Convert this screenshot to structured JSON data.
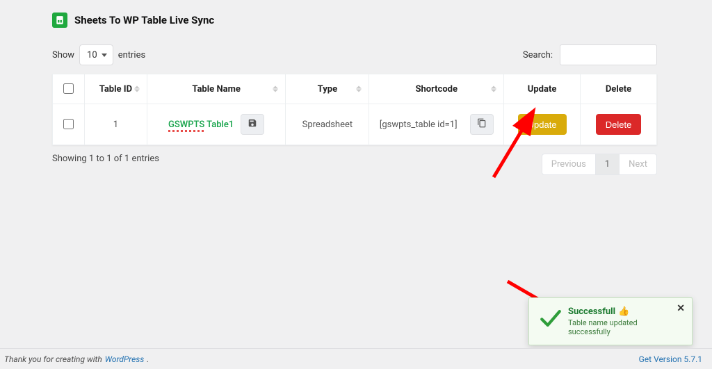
{
  "header": {
    "title": "Sheets To WP Table Live Sync"
  },
  "entries_control": {
    "show_label": "Show",
    "page_size": "10",
    "entries_label": "entries"
  },
  "search": {
    "label": "Search:",
    "value": ""
  },
  "table": {
    "columns": {
      "id": "Table ID",
      "name": "Table Name",
      "type": "Type",
      "shortcode": "Shortcode",
      "update": "Update",
      "delete": "Delete"
    },
    "rows": [
      {
        "id": "1",
        "name": "GSWPTS Table1",
        "type": "Spreadsheet",
        "shortcode": "[gswpts_table id=1]",
        "update_label": "Update",
        "delete_label": "Delete"
      }
    ]
  },
  "footer": {
    "showing_text": "Showing 1 to 1 of 1 entries",
    "prev_label": "Previous",
    "page_current": "1",
    "next_label": "Next"
  },
  "thank_bar": {
    "prefix": "Thank you for creating with ",
    "link_text": "WordPress",
    "suffix": ".",
    "version_text": "Get Version 5.7.1"
  },
  "toast": {
    "title": "Successfull",
    "emoji": "👍",
    "message": "Table name updated successfully"
  }
}
